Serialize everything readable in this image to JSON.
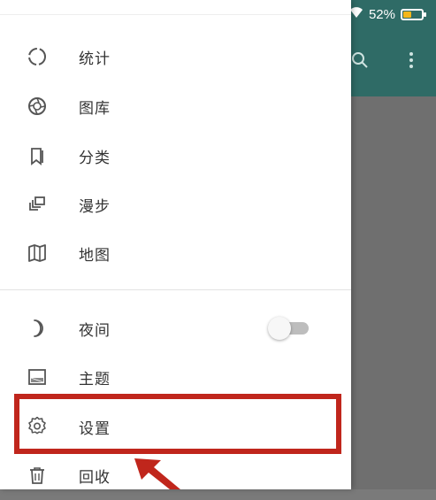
{
  "status_bar": {
    "battery_text": "52%",
    "battery_level": 0.52,
    "battery_fill_color": "#f3b61a"
  },
  "app_bar": {
    "color": "#2f6b66",
    "icons": [
      "search-icon",
      "more-vert-icon"
    ]
  },
  "drawer": {
    "items": [
      {
        "label": "统计",
        "icon": "circle-progress-icon"
      },
      {
        "label": "图库",
        "icon": "aperture-icon"
      },
      {
        "label": "分类",
        "icon": "bookmark-icon"
      },
      {
        "label": "漫步",
        "icon": "slideshow-icon"
      },
      {
        "label": "地图",
        "icon": "map-icon"
      }
    ],
    "settings": [
      {
        "label": "夜间",
        "icon": "moon-icon",
        "toggle_on": false
      },
      {
        "label": "主题",
        "icon": "theme-icon"
      },
      {
        "label": "设置",
        "icon": "gear-icon"
      },
      {
        "label": "回收",
        "icon": "trash-icon"
      }
    ]
  },
  "annotation": {
    "highlight_color": "#c0261c"
  }
}
